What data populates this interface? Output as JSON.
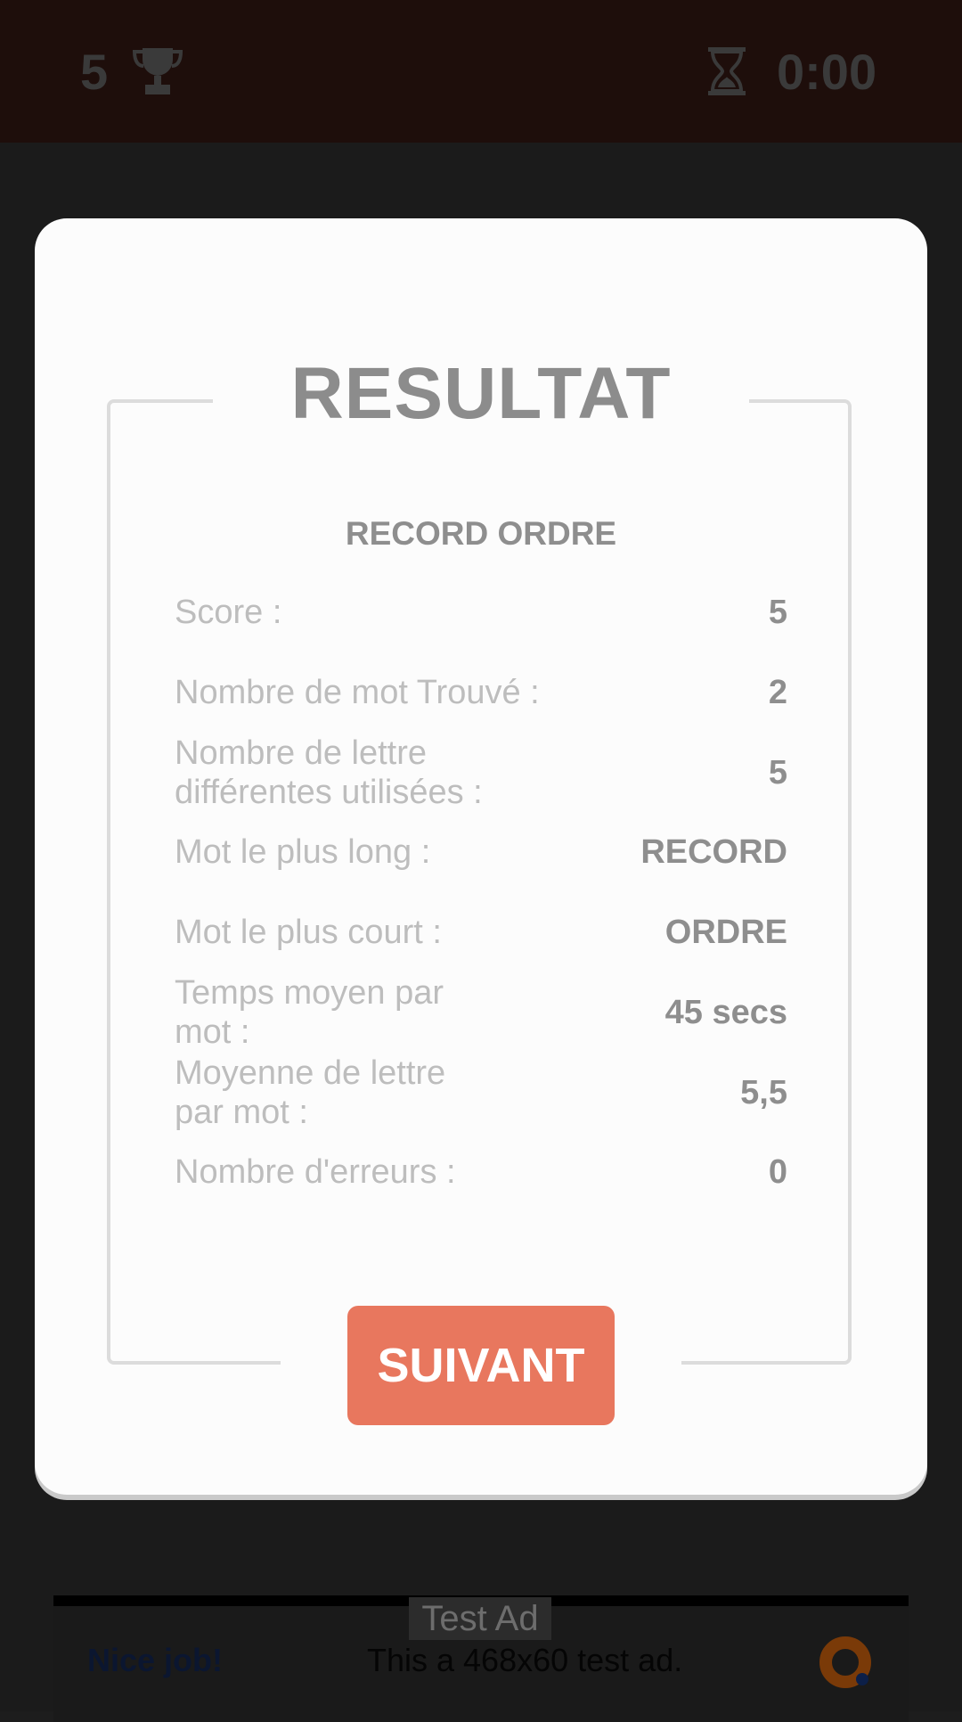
{
  "header": {
    "score": "5",
    "timer": "0:00"
  },
  "modal": {
    "title": "RESULTAT",
    "subtitle": "RECORD ORDRE",
    "rows": [
      {
        "label": "Score :",
        "value": "5"
      },
      {
        "label": "Nombre de mot Trouvé :",
        "value": "2"
      },
      {
        "label": "Nombre de lettre différentes utilisées :",
        "value": "5"
      },
      {
        "label": "Mot le plus long :",
        "value": "RECORD"
      },
      {
        "label": "Mot le plus court :",
        "value": "ORDRE"
      },
      {
        "label": "Temps moyen par mot :",
        "value": "45 secs"
      },
      {
        "label": "Moyenne de lettre par mot :",
        "value": "5,5"
      },
      {
        "label": "Nombre d'erreurs :",
        "value": "0"
      }
    ],
    "next_button": "SUIVANT"
  },
  "ad": {
    "badge": "Test Ad",
    "headline": "Nice job!",
    "text": "This a 468x60 test ad."
  },
  "colors": {
    "accent": "#e8775e",
    "title_gray": "#8c8c8c",
    "label_gray": "#bdbdbd"
  }
}
